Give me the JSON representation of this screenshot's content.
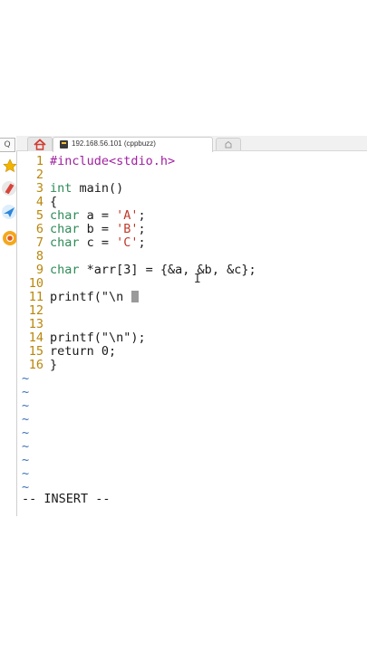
{
  "tabs": {
    "session_title": "192.168.56.101 (cppbuzz)"
  },
  "dock": {
    "search_glyph": "Q"
  },
  "editor": {
    "lines": [
      {
        "n": "1",
        "text": "#include<stdio.h>"
      },
      {
        "n": "2",
        "text": ""
      },
      {
        "n": "3",
        "text": "int main()"
      },
      {
        "n": "4",
        "text": "{"
      },
      {
        "n": "5",
        "text": "char a = 'A';"
      },
      {
        "n": "6",
        "text": "char b = 'B';"
      },
      {
        "n": "7",
        "text": "char c = 'C';"
      },
      {
        "n": "8",
        "text": ""
      },
      {
        "n": "9",
        "text": "char *arr[3] = {&a, &b, &c};"
      },
      {
        "n": "10",
        "text": ""
      },
      {
        "n": "11",
        "text": "printf(\"\\n "
      },
      {
        "n": "12",
        "text": ""
      },
      {
        "n": "13",
        "text": ""
      },
      {
        "n": "14",
        "text": "printf(\"\\n\");"
      },
      {
        "n": "15",
        "text": "return 0;"
      },
      {
        "n": "16",
        "text": "}"
      }
    ],
    "tilde": "~",
    "tilde_count": 9,
    "mode": "-- INSERT --"
  },
  "colors": {
    "line_number": "#b8860b",
    "tilde": "#3b6fb6",
    "type_keyword": "#2e8b57",
    "preprocessor": "#a020a0",
    "string": "#c0392b"
  }
}
